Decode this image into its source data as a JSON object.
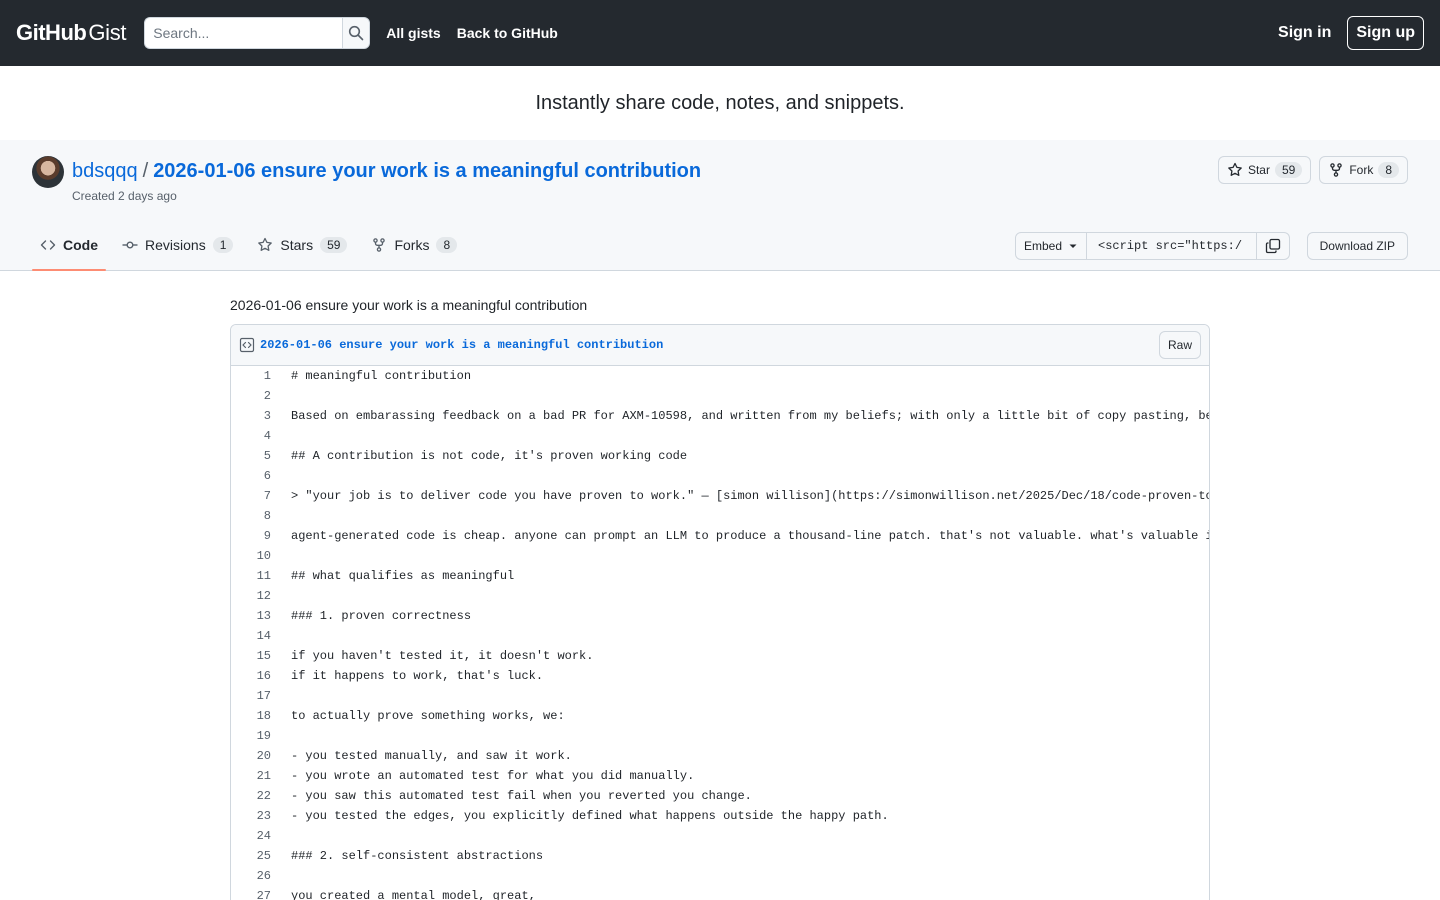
{
  "header": {
    "logo_main": "GitHub",
    "logo_sub": "Gist",
    "search_placeholder": "Search...",
    "links": [
      "All gists",
      "Back to GitHub"
    ],
    "sign_in": "Sign in",
    "sign_up": "Sign up"
  },
  "tagline": "Instantly share code, notes, and snippets.",
  "gist": {
    "owner": "bdsqqq",
    "separator": "/",
    "title": "2026-01-06 ensure your work is a meaningful contribution",
    "created": "Created 2 days ago",
    "star_label": "Star",
    "star_count": "59",
    "fork_label": "Fork",
    "fork_count": "8"
  },
  "tabs": [
    {
      "label": "Code",
      "count": null
    },
    {
      "label": "Revisions",
      "count": "1"
    },
    {
      "label": "Stars",
      "count": "59"
    },
    {
      "label": "Forks",
      "count": "8"
    }
  ],
  "embed": {
    "label": "Embed",
    "value": "<script src=\"https:/"
  },
  "download_label": "Download ZIP",
  "description": "2026-01-06 ensure your work is a meaningful contribution",
  "file": {
    "name": "2026-01-06 ensure your work is a meaningful contribution",
    "raw_label": "Raw",
    "lines": [
      "# meaningful contribution",
      "",
      "Based on embarassing feedback on a bad PR for AXM-10598, and written from my beliefs; with only a little bit of copy pasting, be",
      "",
      "## A contribution is not code, it's proven working code",
      "",
      "> \"your job is to deliver code you have proven to work.\" — [simon willison](https://simonwillison.net/2025/Dec/18/code-proven-to",
      "",
      "agent-generated code is cheap. anyone can prompt an LLM to produce a thousand-line patch. that's not valuable. what's valuable i",
      "",
      "## what qualifies as meaningful",
      "",
      "### 1. proven correctness",
      "",
      "if you haven't tested it, it doesn't work.",
      "if it happens to work, that's luck.",
      "",
      "to actually prove something works, we:",
      "",
      "- you tested manually, and saw it work.",
      "- you wrote an automated test for what you did manually.",
      "- you saw this automated test fail when you reverted you change.",
      "- you tested the edges, you explicitly defined what happens outside the happy path.",
      "",
      "### 2. self-consistent abstractions",
      "",
      "you created a mental model, great,"
    ]
  }
}
